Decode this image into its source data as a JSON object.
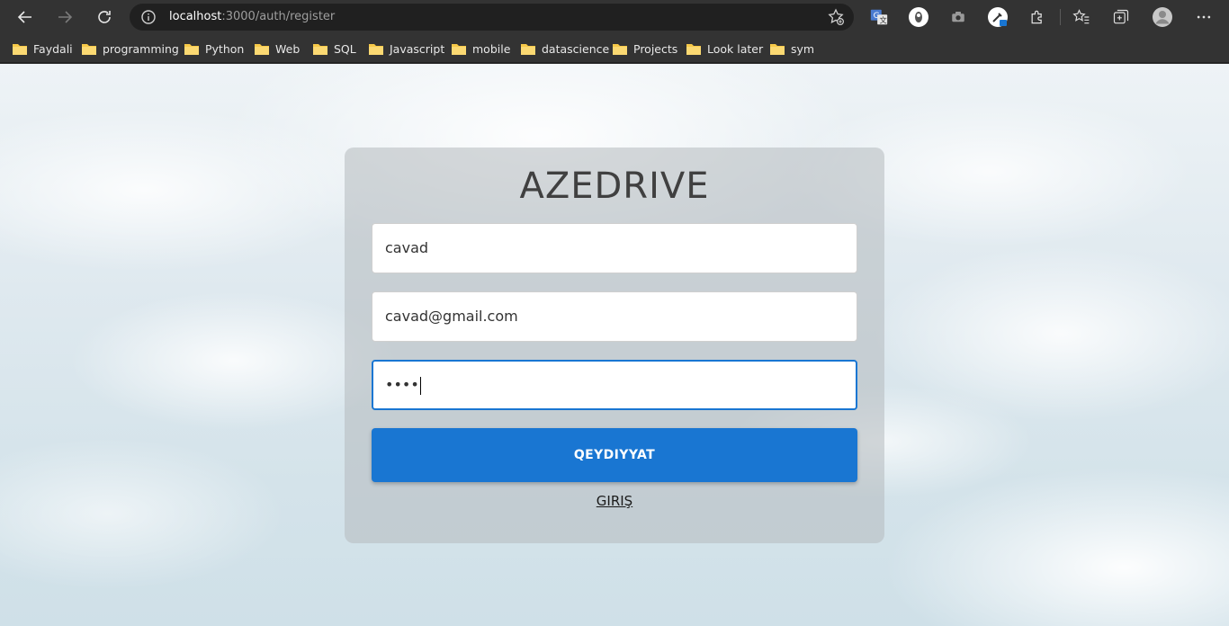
{
  "browser": {
    "url_host": "localhost",
    "url_rest": ":3000/auth/register",
    "bookmarks": [
      "Faydali",
      "programming",
      "Python",
      "Web",
      "SQL",
      "Javascript",
      "mobile",
      "datascience",
      "Projects",
      "Look later",
      "sym"
    ],
    "icons": [
      "back-icon",
      "forward-icon",
      "reload-icon",
      "info-icon",
      "add-favorite-icon",
      "translate-icon",
      "extension-icon",
      "camera-icon",
      "eyedropper-icon",
      "puzzle-icon",
      "favorites-icon",
      "collections-icon",
      "profile-icon",
      "more-icon"
    ],
    "folder_color": "#f7c948"
  },
  "form": {
    "brand": "AZEDRIVE",
    "username_value": "cavad",
    "email_value": "cavad@gmail.com",
    "password_masked": "••••",
    "submit_label": "QEYDIYYAT",
    "login_link": "GIRIŞ",
    "accent_color": "#1976d2"
  }
}
